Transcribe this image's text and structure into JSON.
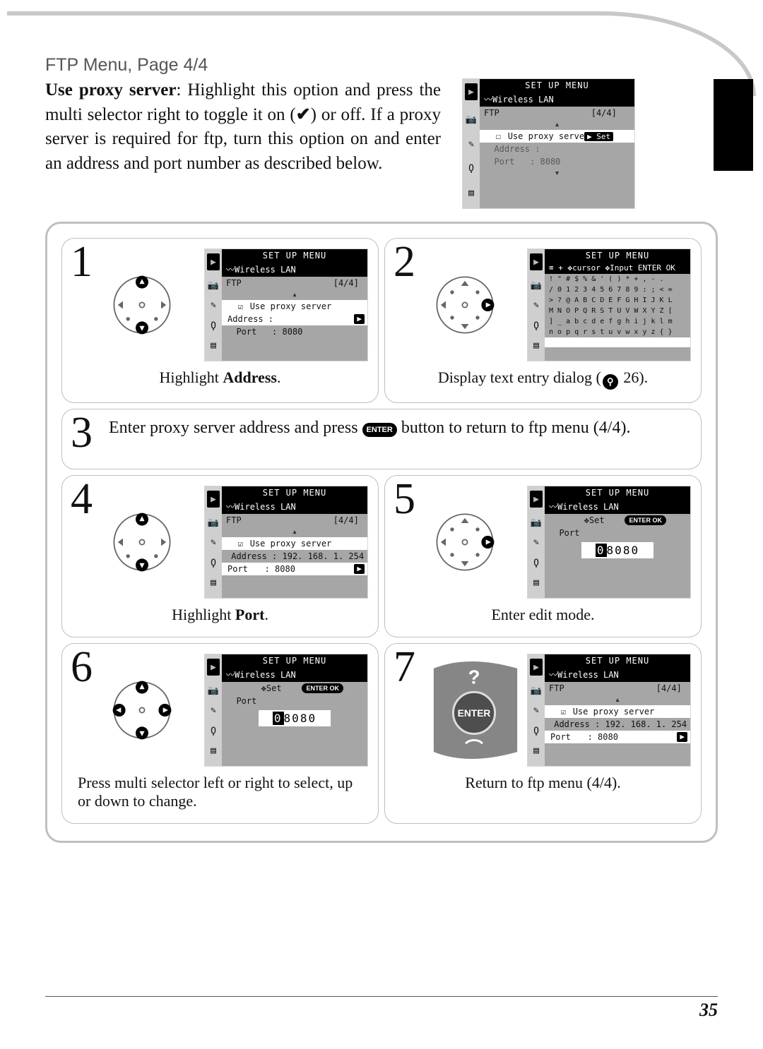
{
  "page": {
    "section_title": "FTP Menu, Page 4/4",
    "number": "35"
  },
  "intro": {
    "bold_lead": "Use proxy server",
    "body_1": ": Highlight this option and press the multi selector right to toggle it on (",
    "check": "✔",
    "body_2": ") or off.  If a proxy server is required for ftp, turn this option on and enter an address and port number as described below."
  },
  "intro_screen": {
    "title": "SET UP MENU",
    "sub": "Wireless LAN",
    "row_ftp_left": "FTP",
    "row_ftp_right": "[4/4]",
    "option": "Use proxy serve",
    "option_btn": "▶ Set",
    "addr_label": "Address :",
    "port_label": "Port",
    "port_val": ": 8080"
  },
  "steps": {
    "s1": {
      "num": "1",
      "caption_pre": "Highlight ",
      "caption_bold": "Address",
      "caption_post": ".",
      "screen": {
        "title": "SET UP MENU",
        "sub": "Wireless LAN",
        "row_ftp_left": "FTP",
        "row_ftp_right": "[4/4]",
        "option_check": "☑",
        "option": "Use proxy server",
        "addr_label": "Address :",
        "port_label": "Port",
        "port_val": ": 8080"
      }
    },
    "s2": {
      "num": "2",
      "caption_pre": "Display text entry dialog (",
      "caption_post": " 26).",
      "screen": {
        "title": "SET UP MENU",
        "helpbar": "⌧ + ✥cursor ✥Input  ENTER OK",
        "kb_l1": "! \" # $ % & ' ( ) * + , - .",
        "kb_l2": "/ 0 1 2 3 4 5 6 7 8 9 : ; < =",
        "kb_l3": "> ? @ A B C D E F G H I J K L",
        "kb_l4": "M N O P Q R S T U V W X Y Z [",
        "kb_l5": "] _ a b c d e f g h i j k l m",
        "kb_l6": "n o p q r s t u v w x y z { }"
      }
    },
    "s3": {
      "num": "3",
      "text_pre": "Enter proxy server address and press ",
      "text_post": " button to return to ftp menu (4/4).",
      "enter_label": "ENTER"
    },
    "s4": {
      "num": "4",
      "caption_pre": "Highlight ",
      "caption_bold": "Port",
      "caption_post": ".",
      "screen": {
        "title": "SET UP MENU",
        "sub": "Wireless LAN",
        "row_ftp_left": "FTP",
        "row_ftp_right": "[4/4]",
        "option_check": "☑",
        "option": "Use proxy server",
        "addr_label": "Address",
        "addr_val": ": 192. 168. 1. 254",
        "port_label": "Port",
        "port_val": ": 8080"
      }
    },
    "s5": {
      "num": "5",
      "caption": "Enter edit mode.",
      "screen": {
        "title": "SET UP MENU",
        "sub": "Wireless LAN",
        "helpbar_set": "✥Set",
        "helpbar_ok": "ENTER OK",
        "port_label": "Port",
        "port_value_prefix": "0",
        "port_value_rest": "8080"
      }
    },
    "s6": {
      "num": "6",
      "caption": "Press multi selector left or right to select, up or down to change.",
      "screen": {
        "title": "SET UP MENU",
        "sub": "Wireless LAN",
        "helpbar_set": "✥Set",
        "helpbar_ok": "ENTER OK",
        "port_label": "Port",
        "port_value_prefix": "0",
        "port_value_rest": "8080"
      }
    },
    "s7": {
      "num": "7",
      "caption": "Return to ftp menu (4/4).",
      "enter_label": "ENTER",
      "screen": {
        "title": "SET UP MENU",
        "sub": "Wireless LAN",
        "row_ftp_left": "FTP",
        "row_ftp_right": "[4/4]",
        "option_check": "☑",
        "option": "Use proxy server",
        "addr_label": "Address",
        "addr_val": ": 192. 168. 1. 254",
        "port_label": "Port",
        "port_val": ": 8080"
      }
    }
  }
}
